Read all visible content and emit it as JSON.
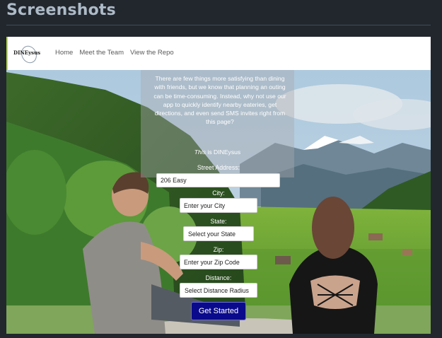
{
  "page": {
    "heading": "Screenshots"
  },
  "app": {
    "logo_text": "DINEysus",
    "nav": [
      {
        "label": "Home"
      },
      {
        "label": "Meet the Team"
      },
      {
        "label": "View the Repo"
      }
    ],
    "intro": "There are few things more satisfying than dining with friends, but we know that planning an outing can be time-consuming. Instead, why not use our app to quickly identify nearby eateries, get directions, and even send SMS invites right from this page?",
    "tagline_prefix": "This",
    "tagline_suffix": " is DINEysus",
    "form": {
      "street_label": "Street Address:",
      "street_value": "206 Easy",
      "city_label": "City:",
      "city_placeholder": "Enter your City",
      "state_label": "State:",
      "state_selected": "Select your State",
      "zip_label": "Zip:",
      "zip_placeholder": "Enter your Zip Code",
      "distance_label": "Distance:",
      "distance_selected": "Select Distance Radius",
      "submit_label": "Get Started"
    },
    "colors": {
      "accent_border": "#b7d84b",
      "button_bg": "#0a0a8c"
    }
  }
}
